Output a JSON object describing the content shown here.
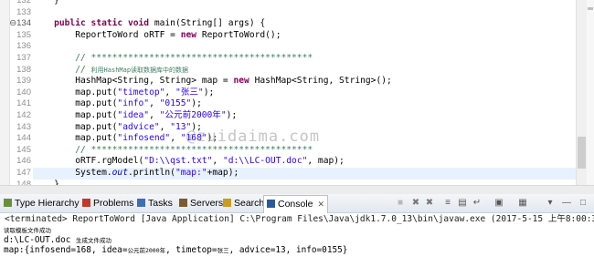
{
  "editor": {
    "line_numbers": [
      "132",
      "133",
      "134",
      "135",
      "136",
      "137",
      "138",
      "139",
      "140",
      "141",
      "142",
      "143",
      "144",
      "145",
      "146",
      "147",
      "148",
      "149",
      "150"
    ],
    "lines": [
      [
        {
          "t": "    }",
          "c": ""
        }
      ],
      [
        {
          "t": "",
          "c": ""
        }
      ],
      [
        {
          "t": "    ",
          "c": ""
        },
        {
          "t": "public static void",
          "c": "kw"
        },
        {
          "t": " main(String[] args) {",
          "c": ""
        }
      ],
      [
        {
          "t": "        ReportToWord oRTF = ",
          "c": ""
        },
        {
          "t": "new",
          "c": "kw"
        },
        {
          "t": " ReportToWord();",
          "c": ""
        }
      ],
      [
        {
          "t": "",
          "c": ""
        }
      ],
      [
        {
          "t": "        // ******************************************",
          "c": "cmt"
        }
      ],
      [
        {
          "t": "        // ",
          "c": "cmt"
        },
        {
          "t": "利用HashMap读取数据库中的数据",
          "c": "cmt cjk"
        }
      ],
      [
        {
          "t": "        HashMap<String, String> map = ",
          "c": ""
        },
        {
          "t": "new",
          "c": "kw"
        },
        {
          "t": " HashMap<String, String>();",
          "c": ""
        }
      ],
      [
        {
          "t": "        map.put(",
          "c": ""
        },
        {
          "t": "\"timetop\"",
          "c": "str"
        },
        {
          "t": ", ",
          "c": ""
        },
        {
          "t": "\"张三\"",
          "c": "str"
        },
        {
          "t": ");",
          "c": ""
        }
      ],
      [
        {
          "t": "        map.put(",
          "c": ""
        },
        {
          "t": "\"info\"",
          "c": "str"
        },
        {
          "t": ", ",
          "c": ""
        },
        {
          "t": "\"0155\"",
          "c": "str"
        },
        {
          "t": ");",
          "c": ""
        }
      ],
      [
        {
          "t": "        map.put(",
          "c": ""
        },
        {
          "t": "\"idea\"",
          "c": "str"
        },
        {
          "t": ", ",
          "c": ""
        },
        {
          "t": "\"公元前2000年\"",
          "c": "str"
        },
        {
          "t": ");",
          "c": ""
        }
      ],
      [
        {
          "t": "        map.put(",
          "c": ""
        },
        {
          "t": "\"advice\"",
          "c": "str"
        },
        {
          "t": ", ",
          "c": ""
        },
        {
          "t": "\"13\"",
          "c": "str"
        },
        {
          "t": ");",
          "c": ""
        }
      ],
      [
        {
          "t": "        map.put(",
          "c": ""
        },
        {
          "t": "\"infosend\"",
          "c": "str"
        },
        {
          "t": ", ",
          "c": ""
        },
        {
          "t": "\"168\"",
          "c": "str"
        },
        {
          "t": ");",
          "c": ""
        }
      ],
      [
        {
          "t": "        // ******************************************",
          "c": "cmt"
        }
      ],
      [
        {
          "t": "        oRTF.rgModel(",
          "c": ""
        },
        {
          "t": "\"D:\\\\qst.txt\"",
          "c": "str"
        },
        {
          "t": ", ",
          "c": ""
        },
        {
          "t": "\"d:\\\\LC-OUT.doc\"",
          "c": "str"
        },
        {
          "t": ", map);",
          "c": ""
        }
      ],
      [
        {
          "t": "        System.",
          "c": ""
        },
        {
          "t": "out",
          "c": "fld"
        },
        {
          "t": ".println(",
          "c": ""
        },
        {
          "t": "\"map:\"",
          "c": "str"
        },
        {
          "t": "+map);",
          "c": ""
        }
      ],
      [
        {
          "t": "    }",
          "c": ""
        }
      ],
      [
        {
          "t": "}",
          "c": ""
        }
      ],
      [
        {
          "t": "",
          "c": ""
        }
      ]
    ],
    "highlighted_line_index": 15,
    "fold_marker_line_index": 2,
    "watermark": "@zuidaima.com"
  },
  "console_view": {
    "tabs": [
      {
        "label": "Type Hierarchy",
        "icon": "type-hierarchy-icon",
        "color": "#6a8f3c"
      },
      {
        "label": "Problems",
        "icon": "problems-icon",
        "color": "#c0392b"
      },
      {
        "label": "Tasks",
        "icon": "tasks-icon",
        "color": "#3d6db4"
      },
      {
        "label": "Servers",
        "icon": "servers-icon",
        "color": "#7b5a2f"
      },
      {
        "label": "Search",
        "icon": "search-icon",
        "color": "#c99b1e"
      },
      {
        "label": "Console",
        "icon": "console-icon",
        "color": "#2a5a9a",
        "active": true
      }
    ],
    "toolbar_icons": [
      "terminate-icon",
      "remove-launch-icon",
      "remove-all-icon",
      "scroll-lock-icon",
      "pin-console-icon",
      "word-wrap-icon",
      "display-selected-icon",
      "open-console-icon",
      "view-menu-icon",
      "minimize-icon",
      "maximize-icon"
    ],
    "status": "<terminated> ReportToWord [Java Application] C:\\Program Files\\Java\\jdk1.7.0_13\\bin\\javaw.exe (2017-5-15 上午8:00:31)",
    "output_lines": [
      [
        {
          "t": "读取模板文件成功",
          "c": "cjk"
        }
      ],
      [
        {
          "t": "d:\\LC-OUT.doc ",
          "c": ""
        },
        {
          "t": "生成文件成功",
          "c": "cjk"
        }
      ],
      [
        {
          "t": "map:{infosend=168, idea=",
          "c": ""
        },
        {
          "t": "公元前2000年",
          "c": "cjk"
        },
        {
          "t": ", timetop=",
          "c": ""
        },
        {
          "t": "张三",
          "c": "cjk"
        },
        {
          "t": ", advice=13, info=0155}",
          "c": ""
        }
      ]
    ]
  }
}
